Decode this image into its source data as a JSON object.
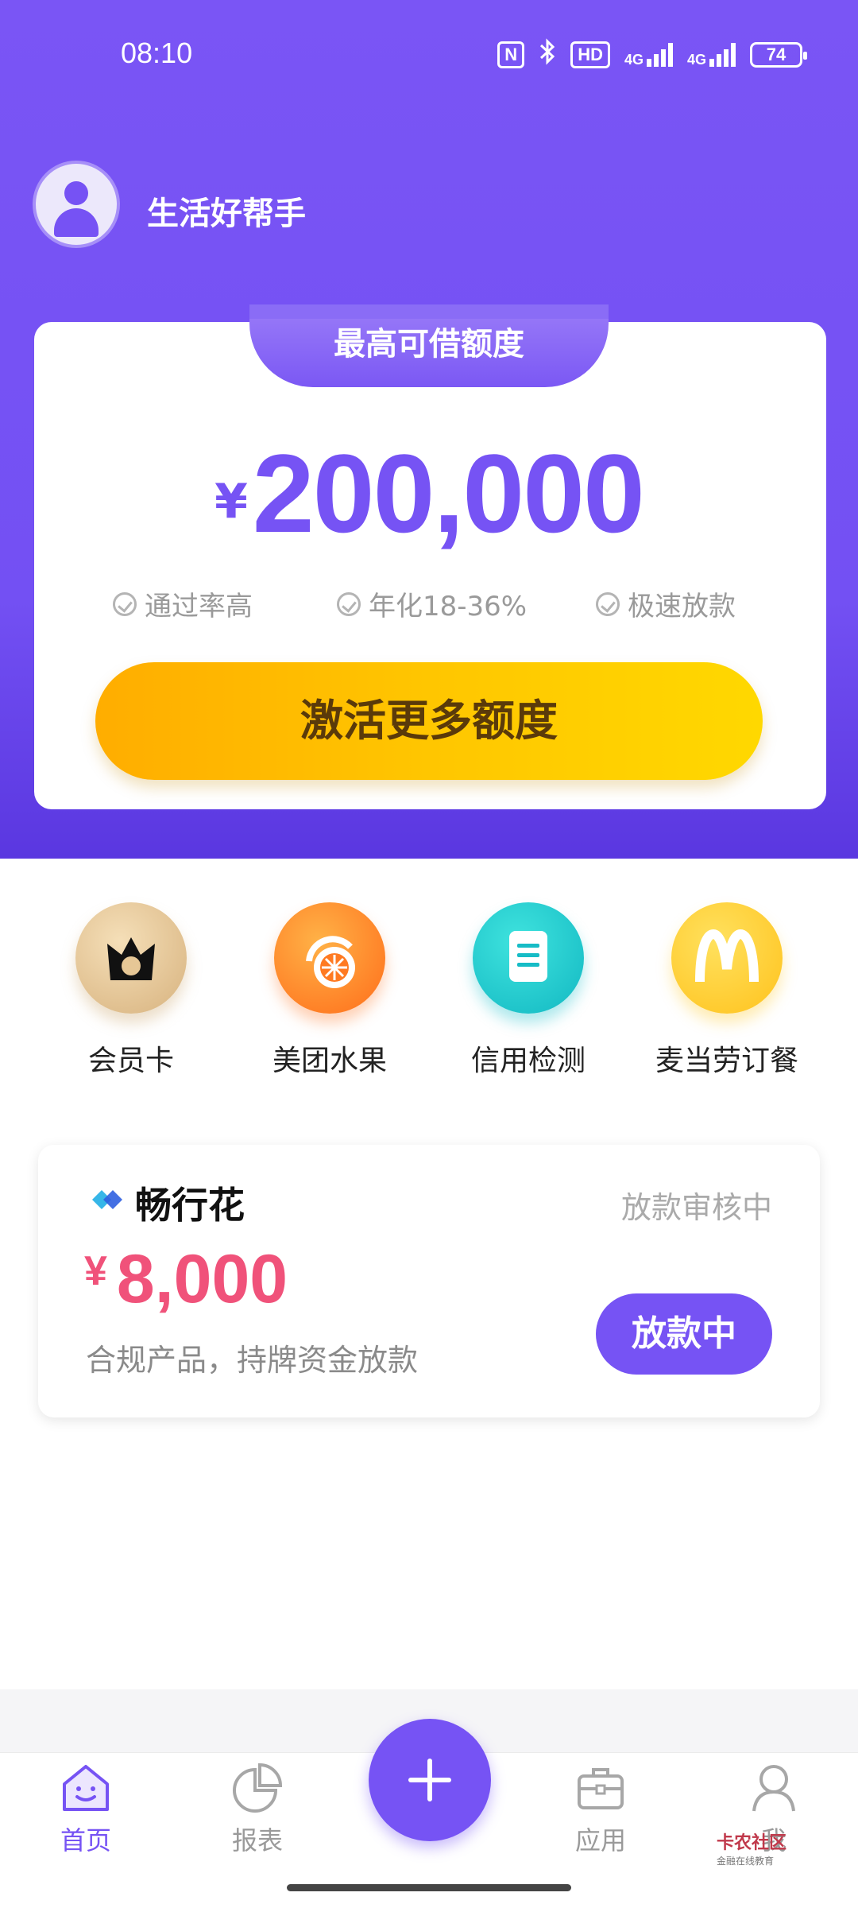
{
  "status_bar": {
    "time": "08:10",
    "nfc": "N",
    "hd_label": "HD",
    "net1": "4G",
    "net2": "4G",
    "battery": "74"
  },
  "header": {
    "username": "生活好帮手"
  },
  "credit_card": {
    "tab_label": "最高可借额度",
    "currency": "¥",
    "amount": "200,000",
    "features": [
      "通过率高",
      "年化18-36%",
      "极速放款"
    ],
    "cta_label": "激活更多额度"
  },
  "shortcuts": [
    {
      "label": "会员卡",
      "icon": "crown-icon"
    },
    {
      "label": "美团水果",
      "icon": "fruit-icon"
    },
    {
      "label": "信用检测",
      "icon": "document-icon"
    },
    {
      "label": "麦当劳订餐",
      "icon": "mcdonalds-icon"
    }
  ],
  "loan": {
    "name": "畅行花",
    "status": "放款审核中",
    "currency": "¥",
    "amount": "8,000",
    "description": "合规产品，持牌资金放款",
    "button_label": "放款中"
  },
  "tabbar": {
    "items": [
      {
        "label": "首页",
        "active": true
      },
      {
        "label": "报表",
        "active": false
      },
      {
        "label": "应用",
        "active": false
      },
      {
        "label": "我",
        "active": false
      }
    ]
  },
  "watermark": {
    "title": "卡农社区",
    "subtitle": "金融在线教育"
  },
  "colors": {
    "brand": "#7653f4",
    "cta": "#ffc600",
    "loan_amount": "#f0527a"
  }
}
